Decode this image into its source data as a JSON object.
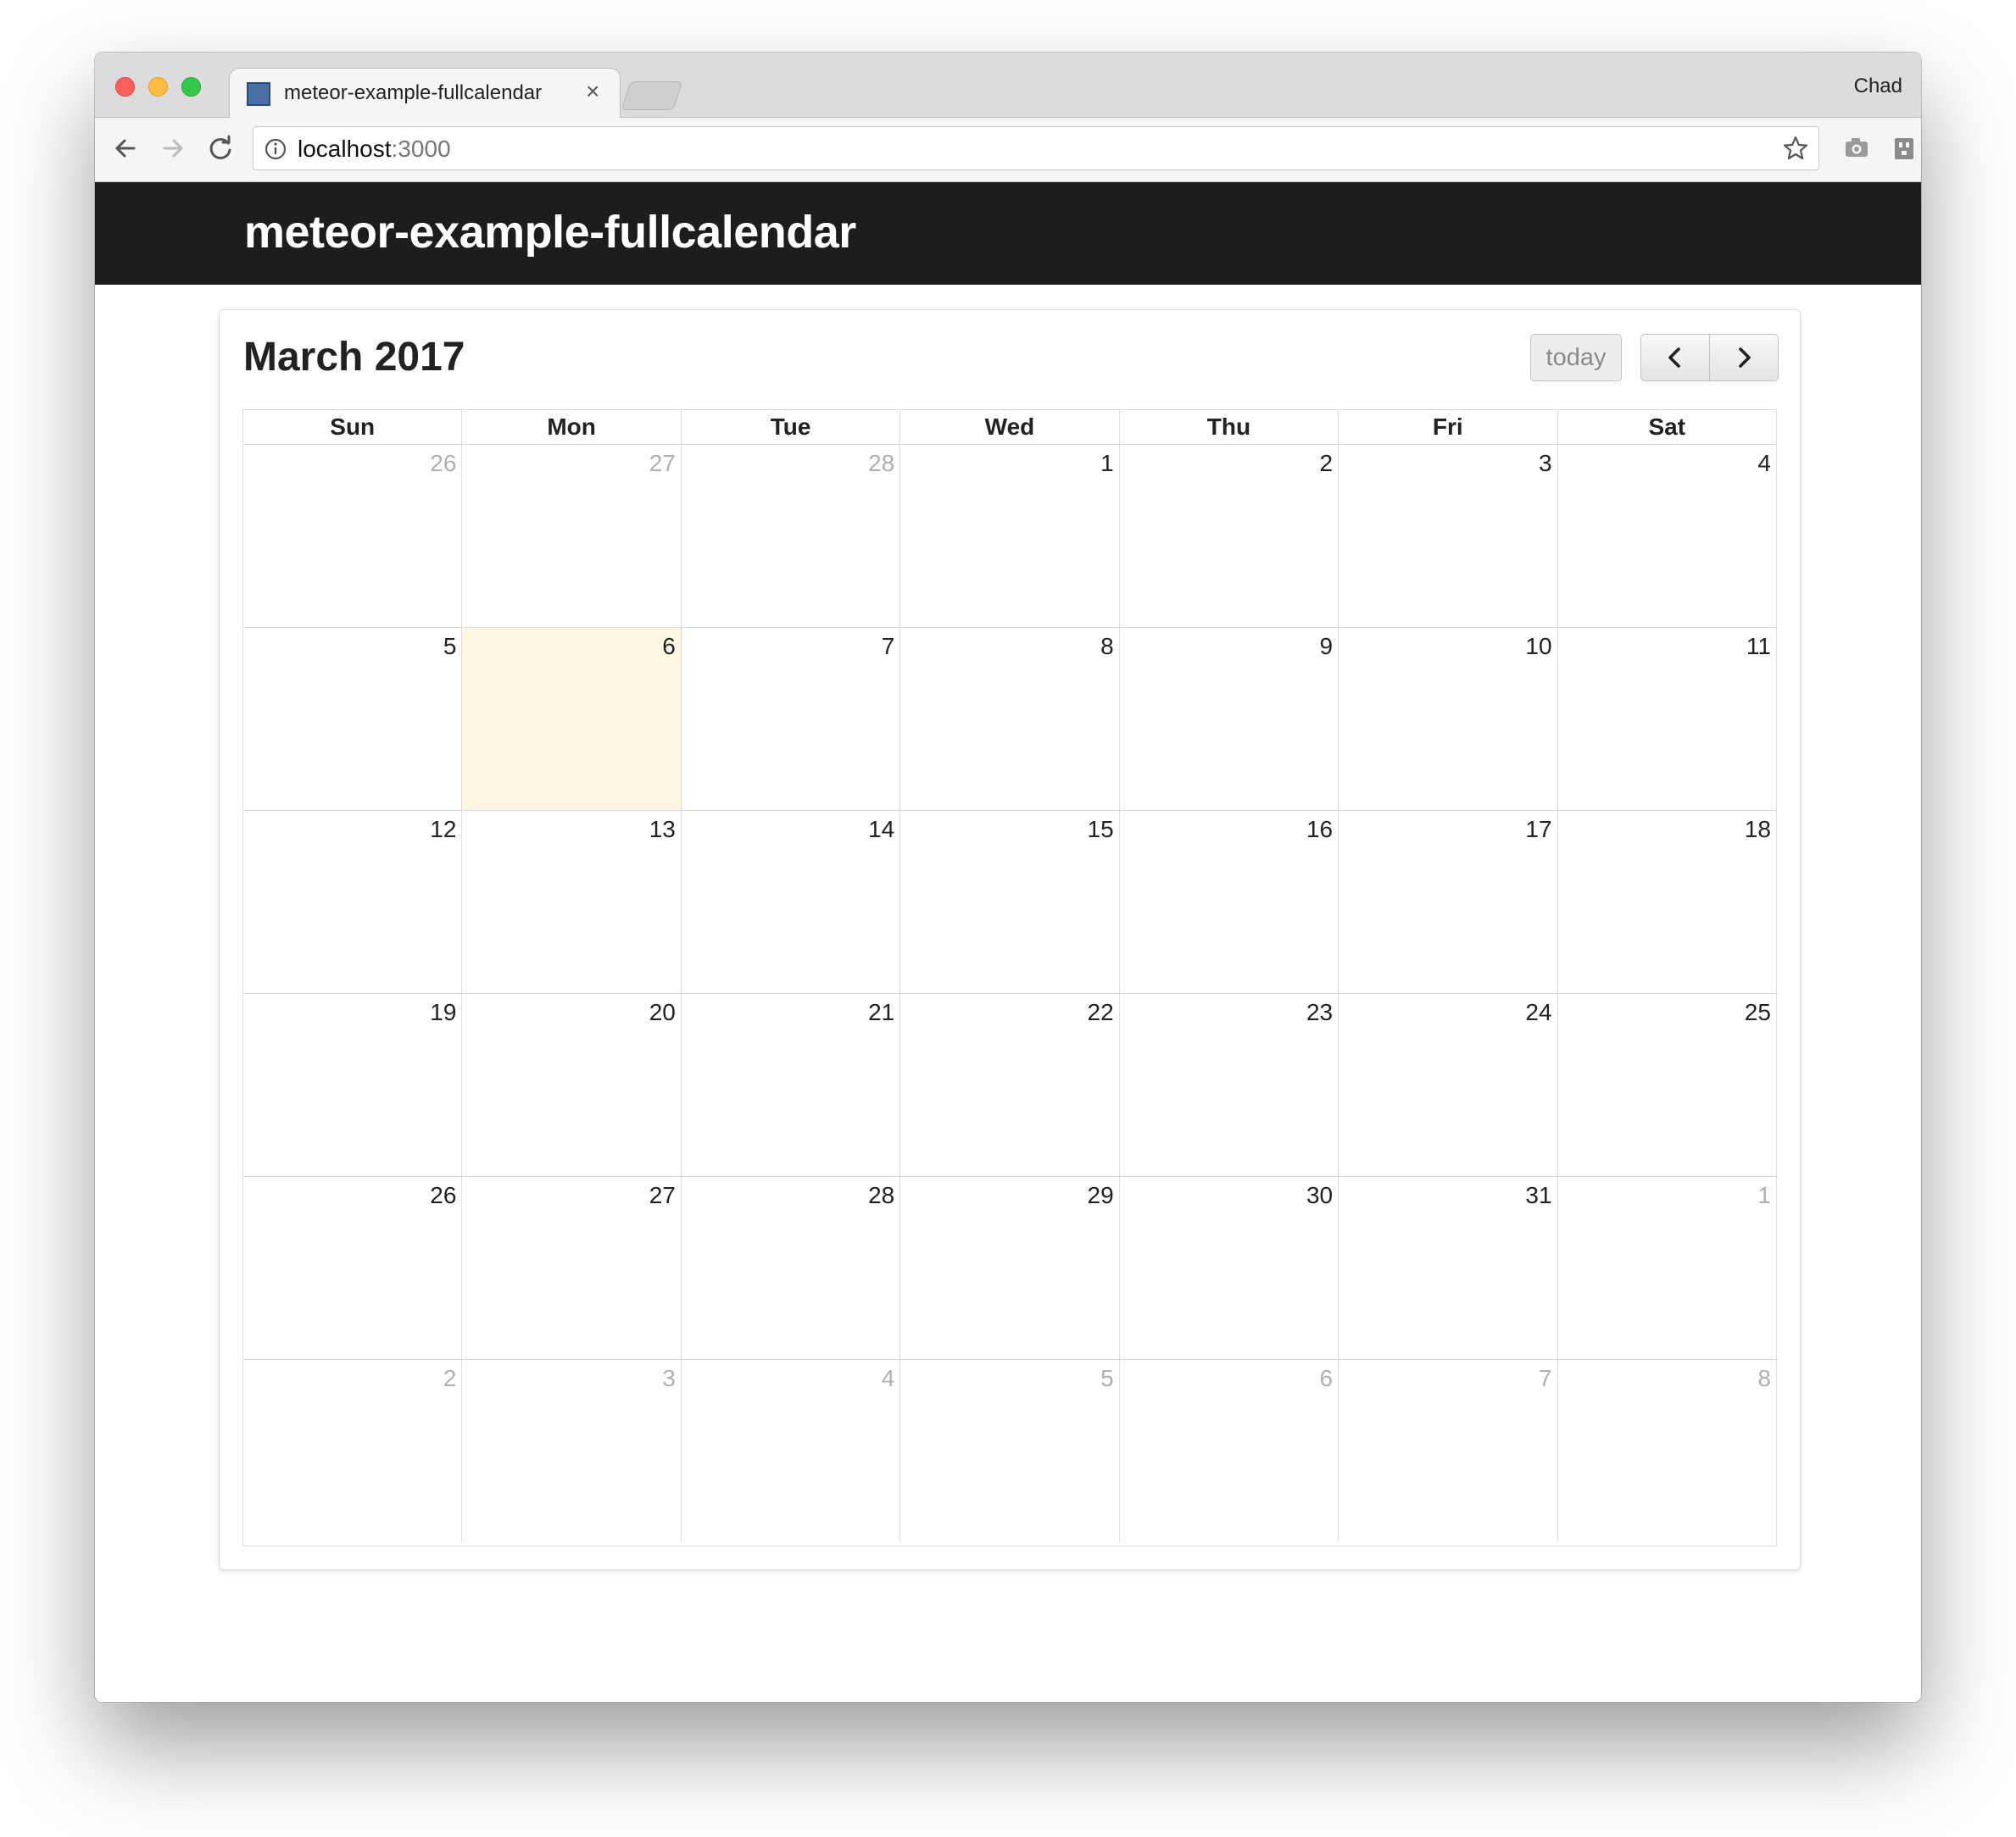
{
  "browser": {
    "tab_title": "meteor-example-fullcalendar",
    "tab_close": "×",
    "profile_name": "Chad",
    "url_host": "localhost",
    "url_port": ":3000"
  },
  "app": {
    "brand": "meteor-example-fullcalendar"
  },
  "calendar": {
    "title": "March 2017",
    "today_label": "today",
    "prev_label": "prev",
    "next_label": "next",
    "day_headers": [
      "Sun",
      "Mon",
      "Tue",
      "Wed",
      "Thu",
      "Fri",
      "Sat"
    ],
    "weeks": [
      [
        {
          "d": "26",
          "other": true
        },
        {
          "d": "27",
          "other": true
        },
        {
          "d": "28",
          "other": true
        },
        {
          "d": "1"
        },
        {
          "d": "2"
        },
        {
          "d": "3"
        },
        {
          "d": "4"
        }
      ],
      [
        {
          "d": "5"
        },
        {
          "d": "6",
          "today": true
        },
        {
          "d": "7"
        },
        {
          "d": "8"
        },
        {
          "d": "9"
        },
        {
          "d": "10"
        },
        {
          "d": "11"
        }
      ],
      [
        {
          "d": "12"
        },
        {
          "d": "13"
        },
        {
          "d": "14"
        },
        {
          "d": "15"
        },
        {
          "d": "16"
        },
        {
          "d": "17"
        },
        {
          "d": "18"
        }
      ],
      [
        {
          "d": "19"
        },
        {
          "d": "20"
        },
        {
          "d": "21"
        },
        {
          "d": "22"
        },
        {
          "d": "23"
        },
        {
          "d": "24"
        },
        {
          "d": "25"
        }
      ],
      [
        {
          "d": "26"
        },
        {
          "d": "27"
        },
        {
          "d": "28"
        },
        {
          "d": "29"
        },
        {
          "d": "30"
        },
        {
          "d": "31"
        },
        {
          "d": "1",
          "other": true
        }
      ],
      [
        {
          "d": "2",
          "other": true
        },
        {
          "d": "3",
          "other": true
        },
        {
          "d": "4",
          "other": true
        },
        {
          "d": "5",
          "other": true
        },
        {
          "d": "6",
          "other": true
        },
        {
          "d": "7",
          "other": true
        },
        {
          "d": "8",
          "other": true
        }
      ]
    ],
    "colors": {
      "navbar": "#1c1d1f",
      "today_highlight": "#fcf8e3",
      "other_month_text": "#b0b0b0"
    }
  }
}
